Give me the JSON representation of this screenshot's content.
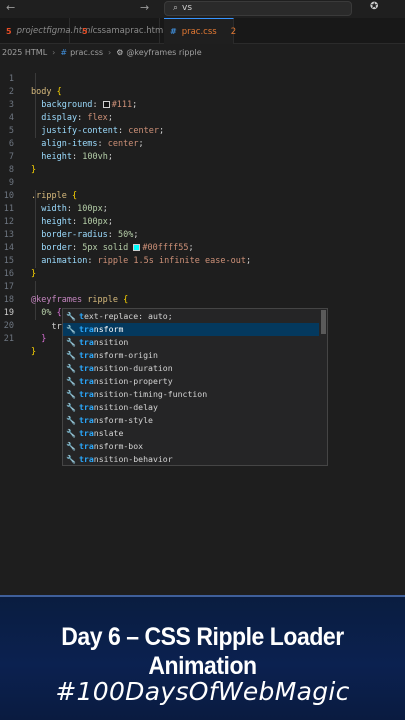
{
  "search": {
    "value": "vs"
  },
  "tabs": [
    {
      "label": "projectfigma.html",
      "icon": "html-icon"
    },
    {
      "label": "cssamaprac.html",
      "icon": "html-icon"
    },
    {
      "label": "prac.css",
      "icon": "css-icon",
      "badge": "2",
      "active": true
    }
  ],
  "breadcrumb": {
    "folder": "2025 HTML",
    "file": "prac.css",
    "symbol": "@keyframes ripple"
  },
  "code_lines": [
    {
      "n": "1"
    },
    {
      "n": "2"
    },
    {
      "n": "3"
    },
    {
      "n": "4"
    },
    {
      "n": "5"
    },
    {
      "n": "6"
    },
    {
      "n": "7"
    },
    {
      "n": "8"
    },
    {
      "n": "9"
    },
    {
      "n": "10"
    },
    {
      "n": "11"
    },
    {
      "n": "12"
    },
    {
      "n": "13"
    },
    {
      "n": "14"
    },
    {
      "n": "15"
    },
    {
      "n": "16"
    },
    {
      "n": "17"
    },
    {
      "n": "18"
    },
    {
      "n": "19"
    },
    {
      "n": "20"
    },
    {
      "n": "21"
    }
  ],
  "code": {
    "body_sel": "body",
    "bg_prop": "background",
    "bg_val": "#111",
    "display_prop": "display",
    "display_val": "flex",
    "jc_prop": "justify-content",
    "jc_val": "center",
    "ai_prop": "align-items",
    "ai_val": "center",
    "height_prop": "height",
    "height_val": "100vh",
    "ripple_sel": ".ripple",
    "width_prop": "width",
    "width_val": "100px",
    "h2_prop": "height",
    "h2_val": "100px",
    "br_prop": "border-radius",
    "br_val": "50%",
    "border_prop": "border",
    "border_val1": "5px solid",
    "border_val2": "#00ffff55",
    "anim_prop": "animation",
    "anim_val": "ripple 1.5s infinite ease-out",
    "at_kw": "@keyframes",
    "kf_name": "ripple",
    "pct": "0%",
    "typed": "tra"
  },
  "colors": {
    "bg_swatch": "#111111",
    "border_swatch": "#00ffff"
  },
  "suggestions": [
    {
      "match": "t",
      "rest": "ext-replace: auto;",
      "pre": ""
    },
    {
      "match": "tra",
      "rest": "nsform",
      "pre": ""
    },
    {
      "match": "tra",
      "rest": "nsition",
      "pre": ""
    },
    {
      "match": "tra",
      "rest": "nsform-origin",
      "pre": ""
    },
    {
      "match": "tra",
      "rest": "nsition-duration",
      "pre": ""
    },
    {
      "match": "tra",
      "rest": "nsition-property",
      "pre": ""
    },
    {
      "match": "tra",
      "rest": "nsition-timing-function",
      "pre": ""
    },
    {
      "match": "tra",
      "rest": "nsition-delay",
      "pre": ""
    },
    {
      "match": "tra",
      "rest": "nsform-style",
      "pre": ""
    },
    {
      "match": "tra",
      "rest": "nslate",
      "pre": ""
    },
    {
      "match": "tra",
      "rest": "nsform-box",
      "pre": ""
    },
    {
      "match": "tra",
      "rest": "nsition-behavior",
      "pre": ""
    }
  ],
  "banner": {
    "title": "Day 6 – CSS Ripple Loader Animation",
    "hashtag": "#100DaysOfWebMagic"
  }
}
